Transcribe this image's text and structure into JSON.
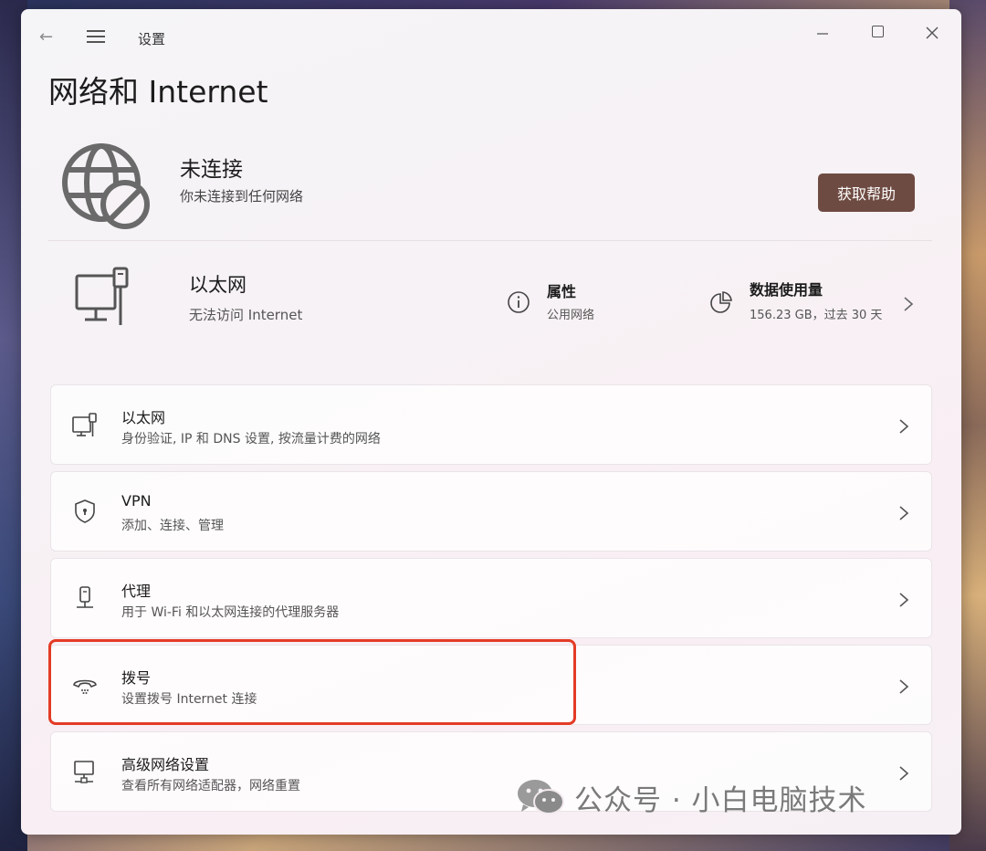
{
  "window": {
    "title": "设置",
    "back_glyph": "←"
  },
  "page": {
    "title": "网络和 Internet"
  },
  "status": {
    "icon": "globe-disconnected-icon",
    "title": "未连接",
    "subtitle": "你未连接到任何网络",
    "help_button": "获取帮助"
  },
  "ethernet_summary": {
    "icon": "ethernet-icon",
    "title": "以太网",
    "subtitle": "无法访问 Internet",
    "properties": {
      "icon": "info-icon",
      "title": "属性",
      "subtitle": "公用网络"
    },
    "data_usage": {
      "icon": "pie-chart-icon",
      "title": "数据使用量",
      "subtitle": "156.23 GB，过去 30 天"
    }
  },
  "cards": [
    {
      "icon": "ethernet-icon",
      "title": "以太网",
      "subtitle": "身份验证, IP 和 DNS 设置, 按流量计费的网络"
    },
    {
      "icon": "shield-icon",
      "title": "VPN",
      "subtitle": "添加、连接、管理"
    },
    {
      "icon": "proxy-icon",
      "title": "代理",
      "subtitle": "用于 Wi-Fi 和以太网连接的代理服务器"
    },
    {
      "icon": "dial-up-icon",
      "title": "拨号",
      "subtitle": "设置拨号 Internet 连接"
    },
    {
      "icon": "network-computer-icon",
      "title": "高级网络设置",
      "subtitle": "查看所有网络适配器，网络重置"
    }
  ],
  "highlight_color": "#e33b25",
  "accent_color": "#6e4b42",
  "watermark": {
    "icon": "wechat-icon",
    "text": "公众号 · 小白电脑技术"
  }
}
